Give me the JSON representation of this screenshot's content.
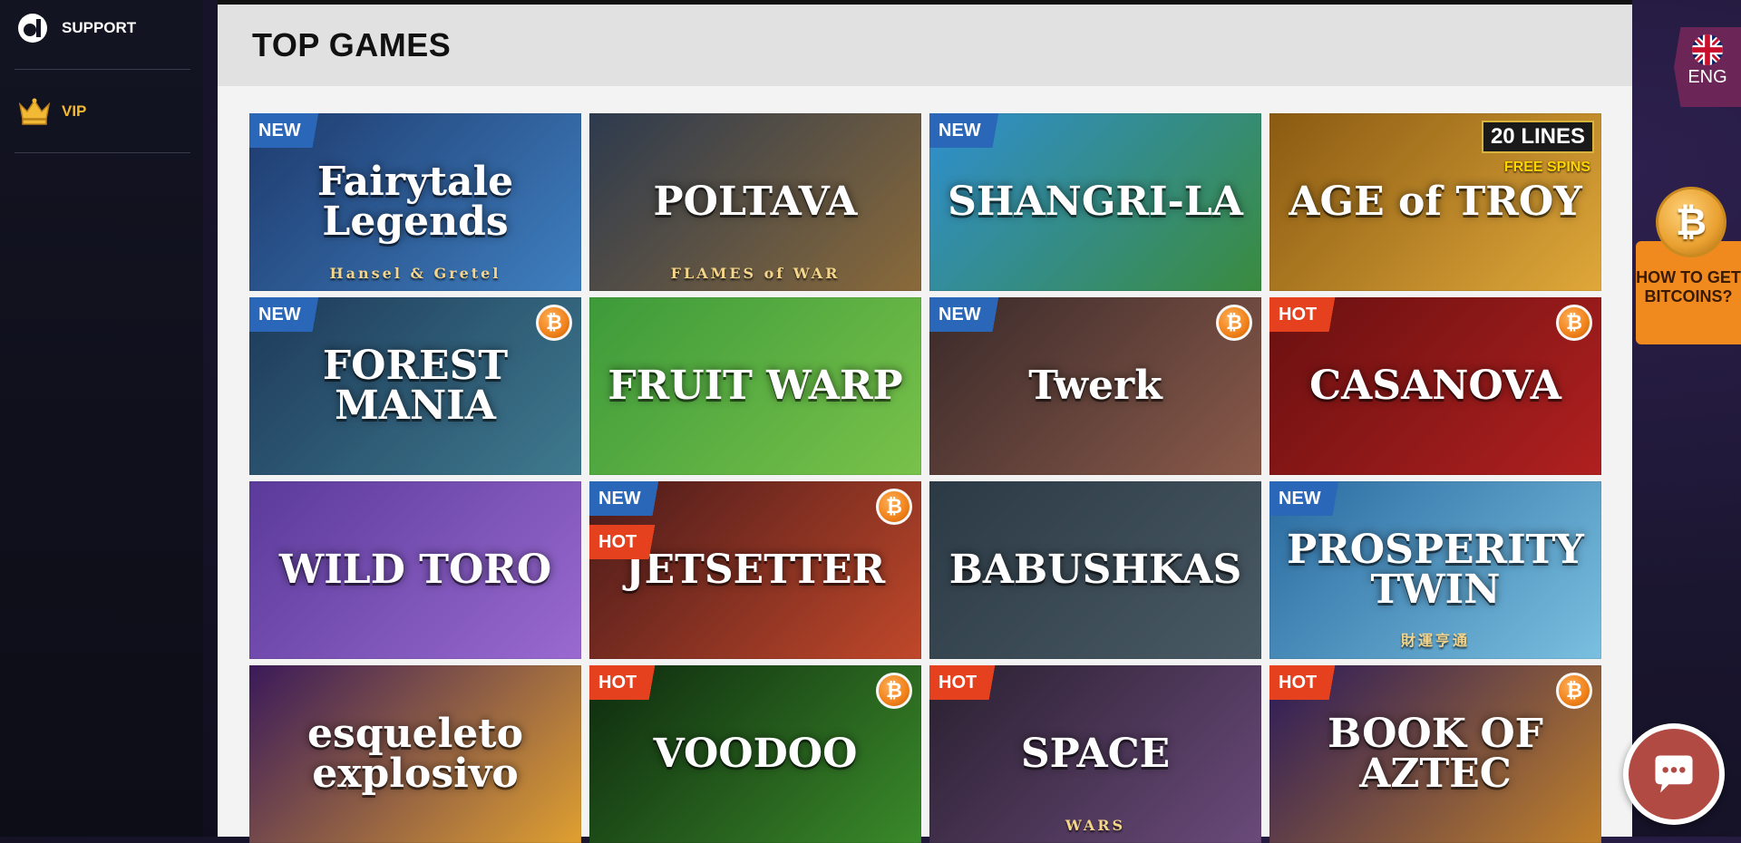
{
  "sidebar": {
    "items": [
      {
        "label": "SUPPORT",
        "icon": "support-logo-icon"
      },
      {
        "label": "VIP",
        "icon": "crown-icon"
      }
    ]
  },
  "main": {
    "title": "TOP GAMES",
    "games": [
      {
        "title": "Fairytale Legends",
        "subtitle": "Hansel & Gretel",
        "badges": [
          "NEW"
        ],
        "bitcoin": false,
        "colors": [
          "#1e3b6e",
          "#3f7fc0"
        ]
      },
      {
        "title": "POLTAVA",
        "subtitle": "FLAMES of WAR",
        "badges": [],
        "bitcoin": false,
        "colors": [
          "#2d3a4e",
          "#8a6a3a"
        ]
      },
      {
        "title": "SHANGRI-LA",
        "subtitle": "",
        "badges": [
          "NEW"
        ],
        "bitcoin": false,
        "colors": [
          "#2f8ed0",
          "#3a8b3e"
        ]
      },
      {
        "title": "AGE of TROY",
        "subtitle": "",
        "badges": [],
        "bitcoin": false,
        "colors": [
          "#8a5a12",
          "#e0a83a"
        ],
        "lines": "20 LINES",
        "free_spins": "FREE SPINS"
      },
      {
        "title": "FOREST MANIA",
        "subtitle": "",
        "badges": [
          "NEW"
        ],
        "bitcoin": true,
        "colors": [
          "#1d3a5a",
          "#3f7a8f"
        ]
      },
      {
        "title": "FRUIT WARP",
        "subtitle": "",
        "badges": [],
        "bitcoin": false,
        "colors": [
          "#3d9a3a",
          "#79c24a"
        ]
      },
      {
        "title": "Twerk",
        "subtitle": "",
        "badges": [
          "NEW"
        ],
        "bitcoin": true,
        "colors": [
          "#3a2a2a",
          "#8a5a4a"
        ]
      },
      {
        "title": "CASANOVA",
        "subtitle": "",
        "badges": [
          "HOT"
        ],
        "bitcoin": true,
        "colors": [
          "#6a1010",
          "#b02020"
        ]
      },
      {
        "title": "WILD TORO",
        "subtitle": "",
        "badges": [],
        "bitcoin": false,
        "colors": [
          "#5a3a9a",
          "#9a6ad0"
        ]
      },
      {
        "title": "JETSETTER",
        "subtitle": "",
        "badges": [
          "NEW",
          "HOT"
        ],
        "bitcoin": true,
        "colors": [
          "#4a1a1a",
          "#c0482a"
        ]
      },
      {
        "title": "BABUSHKAS",
        "subtitle": "",
        "badges": [],
        "bitcoin": false,
        "colors": [
          "#2b3a45",
          "#4a5a65"
        ]
      },
      {
        "title": "PROSPERITY TWIN",
        "subtitle": "財運亨通",
        "badges": [
          "NEW"
        ],
        "bitcoin": false,
        "colors": [
          "#2a6aa0",
          "#7ac0e0"
        ]
      },
      {
        "title": "esqueleto explosivo",
        "subtitle": "",
        "badges": [],
        "bitcoin": false,
        "colors": [
          "#3a1a5a",
          "#e0a030"
        ]
      },
      {
        "title": "VOODOO",
        "subtitle": "",
        "badges": [
          "HOT"
        ],
        "bitcoin": true,
        "colors": [
          "#0e2a0e",
          "#3a8a2a"
        ]
      },
      {
        "title": "SPACE",
        "subtitle": "WARS",
        "badges": [
          "HOT"
        ],
        "bitcoin": false,
        "colors": [
          "#2a2030",
          "#6a4a7a"
        ]
      },
      {
        "title": "BOOK OF AZTEC",
        "subtitle": "",
        "badges": [
          "HOT"
        ],
        "bitcoin": true,
        "colors": [
          "#2a1a5a",
          "#c0802a"
        ]
      }
    ]
  },
  "language": {
    "label": "ENG",
    "icon": "uk-flag-icon"
  },
  "bitcoin_widget": {
    "label": "HOW TO GET BITCOINS?",
    "icon": "bitcoin-icon"
  },
  "chat": {
    "icon": "chat-bubble-icon"
  },
  "colors": {
    "accent_new": "#2a67b8",
    "accent_hot": "#e5411e",
    "bitcoin": "#f0811a",
    "vip": "#f1b934"
  }
}
